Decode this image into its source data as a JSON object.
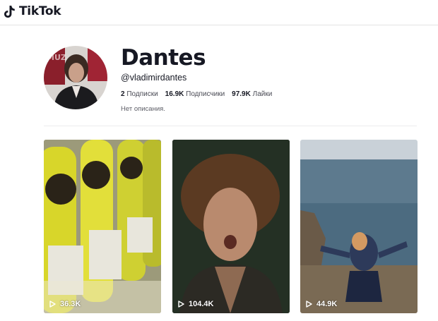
{
  "header": {
    "logo_text": "TikTok",
    "logo_icon": "tiktok-note-icon"
  },
  "profile": {
    "display_name": "Dantes",
    "handle": "@vladimirdantes",
    "stats": [
      {
        "value": "2",
        "label": "Подписки"
      },
      {
        "value": "16.9K",
        "label": "Подписчики"
      },
      {
        "value": "97.9K",
        "label": "Лайки"
      }
    ],
    "bio": "Нет описания."
  },
  "videos": [
    {
      "views": "36.3K",
      "icon": "play-icon"
    },
    {
      "views": "104.4K",
      "icon": "play-icon"
    },
    {
      "views": "44.9K",
      "icon": "play-icon"
    }
  ],
  "colors": {
    "text": "#161823",
    "secondary_text": "#5c5d66",
    "border": "#e3e3e4"
  }
}
